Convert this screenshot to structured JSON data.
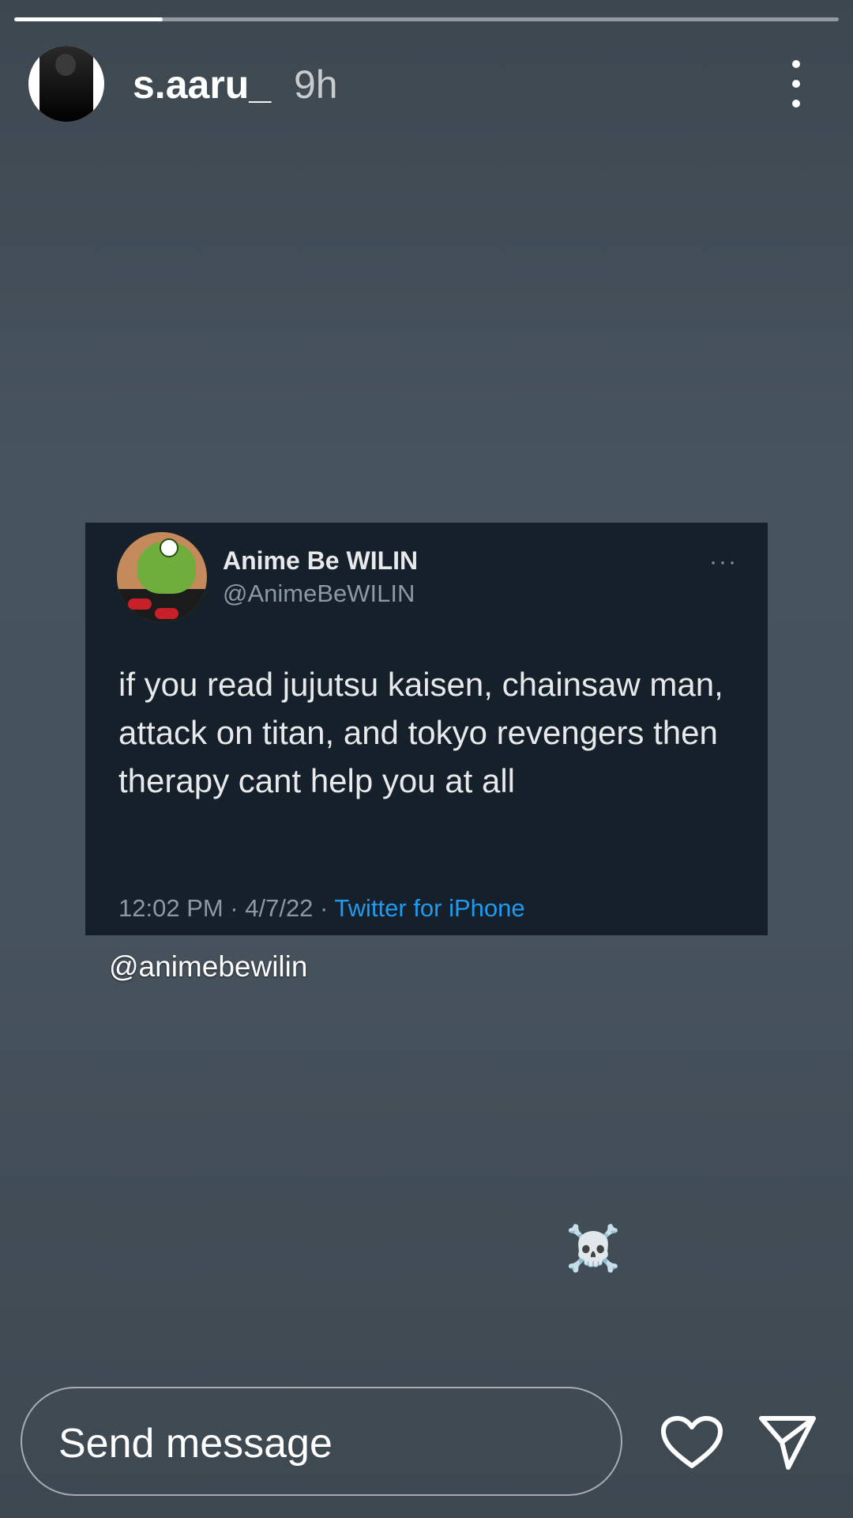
{
  "story": {
    "progress_fraction": 0.18
  },
  "header": {
    "username": "s.aaru_",
    "time": "9h",
    "more_icon": "vertical-dots-icon"
  },
  "tweet": {
    "display_name": "Anime Be WILIN",
    "handle": "@AnimeBeWILIN",
    "more_icon": "horizontal-dots-icon",
    "more_label": "···",
    "text": "if you read jujutsu kaisen, chainsaw man, attack on titan, and tokyo revengers then therapy cant help you at all",
    "time": "12:02 PM · 4/7/22 · ",
    "source": "Twitter for iPhone"
  },
  "mention": "@animebewilin",
  "sticker": "☠️",
  "footer": {
    "message_placeholder": "Send message",
    "like_icon": "heart-icon",
    "share_icon": "send-icon"
  },
  "colors": {
    "tweet_background": "#15202b",
    "link": "#1d9bf0"
  }
}
